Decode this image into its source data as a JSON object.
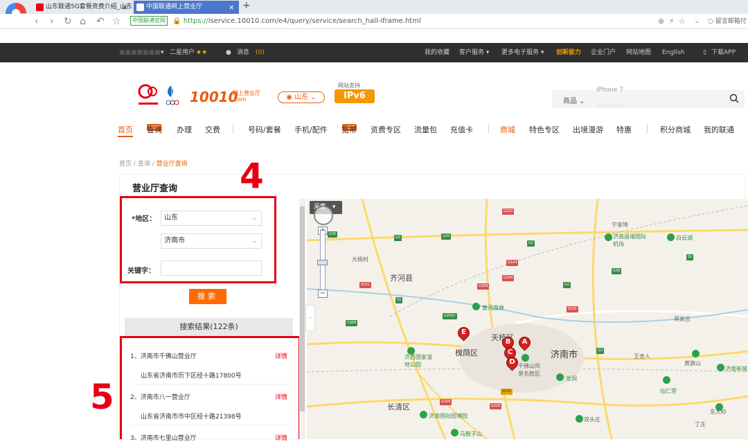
{
  "browser": {
    "tabs": [
      {
        "label": "山东联通5G套餐资费介绍_山东",
        "close": "×"
      },
      {
        "label": "中国联通网上营业厅",
        "close": "×"
      }
    ],
    "new_tab": "+",
    "cert_label": "中国联通官网",
    "url_https": "https://",
    "url_rest": "iservice.10010.com/e4/query/service/search_hall-iframe.html",
    "search_engine": "○ 留言邮箱付"
  },
  "topbar": {
    "user_blur": "■■■■■■■",
    "user_level": "二星用户",
    "stars": "★★",
    "messages": "消息",
    "message_count": "(0)",
    "links": [
      "我的收藏",
      "客户服务 ▾",
      "更多电子服务 ▾",
      "创新能力",
      "企业门户",
      "网站地图",
      "English"
    ],
    "download": "下载APP"
  },
  "header": {
    "logo_text": "10010",
    "logo_sub_top": "网上营业厅",
    "logo_sub_bottom": ".com",
    "region": "山东",
    "ipv6_label": "网站支持",
    "ipv6_badge": "IPv6",
    "search_category": "商品",
    "search_hint": "iPhone 7"
  },
  "mainnav": {
    "items": [
      "首页",
      "查询",
      "办理",
      "交费",
      "号码/套餐",
      "手机/配件",
      "宽带",
      "资费专区",
      "流量包",
      "充值卡",
      "商城",
      "特色专区",
      "出境漫游",
      "特惠",
      "积分商城",
      "我的联通"
    ],
    "hot": "HOT"
  },
  "breadcrumb": {
    "home": "首页",
    "sep": "/",
    "query": "查询",
    "current": "营业厅查询"
  },
  "panel": {
    "title": "营业厅查询"
  },
  "annotations": {
    "box4": "4",
    "box5": "5"
  },
  "form": {
    "region_label": "*地区：",
    "province": "山东",
    "city": "济南市",
    "keyword_label": "关键字：",
    "keyword_value": "",
    "search_button": "搜索"
  },
  "results": {
    "header": "搜索结果(122条)",
    "detail_label": "详情",
    "items": [
      {
        "name": "1、济南市千佛山营业厅",
        "address": "山东省济南市历下区经十路17800号"
      },
      {
        "name": "2、济南市八一营业厅",
        "address": "山东省济南市市中区经十路21398号"
      },
      {
        "name": "3、济南市七里山营业厅",
        "address": ""
      }
    ]
  },
  "map": {
    "type_button": "采集",
    "labels": {
      "jinan": "济南市",
      "qihe": "齐河县",
      "changqing": "长清区",
      "huaiyin": "槐荫区",
      "tianqiao": "天桥区",
      "airport": "济南遥墙国际机场",
      "wetland": "济西国家湿地公园",
      "yellowriver": "黄河森林",
      "qianfo": "千佛山风景名胜区",
      "longdong": "龙洞",
      "xianren": "仙仁堂",
      "baiyun": "白云湖",
      "ningjia": "宁家埠",
      "huangqi": "黄旗山",
      "ecopark": "济南国际园博园",
      "mashan": "马鞍子山",
      "shuangquan": "双头庄",
      "dongda": "东大岭",
      "xincheng": "济南新城",
      "dajiayuan": "大杨村",
      "wangsheren": "王舍人",
      "jiangjia": "蒋家庄",
      "dingzhuang": "丁庄"
    },
    "pins": [
      "A",
      "B",
      "C",
      "D",
      "E"
    ],
    "shields": [
      "G35",
      "G3",
      "G20",
      "G2",
      "G220",
      "G104",
      "G308",
      "S1",
      "S101",
      "G309",
      "G2001",
      "S102",
      "G3",
      "S103",
      "G105",
      "G220",
      "G104",
      "S1",
      "G35",
      "G2"
    ]
  },
  "zoom": {
    "in": "+",
    "out": "−"
  }
}
